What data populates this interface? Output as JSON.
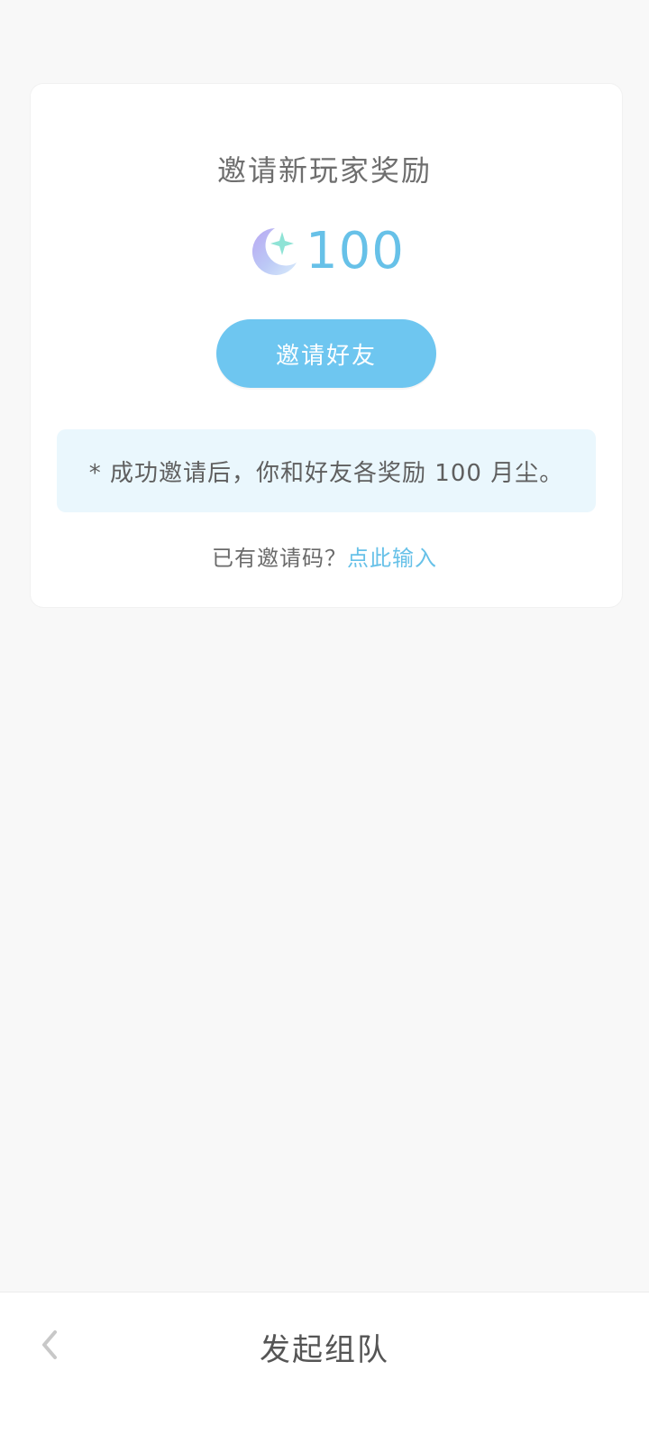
{
  "card": {
    "title": "邀请新玩家奖励",
    "reward_icon": "moon-star-icon",
    "reward_amount": "100",
    "invite_button_label": "邀请好友",
    "note": "* 成功邀请后，你和好友各奖励 100 月尘。",
    "code_prompt": "已有邀请码？",
    "code_link": "点此输入"
  },
  "bottom_bar": {
    "back_icon": "chevron-left-icon",
    "title": "发起组队"
  },
  "colors": {
    "background": "#f8f8f8",
    "card": "#ffffff",
    "accent": "#6ec6f0",
    "accent_text": "#67c1e8",
    "note_bg": "#eaf7fd"
  }
}
